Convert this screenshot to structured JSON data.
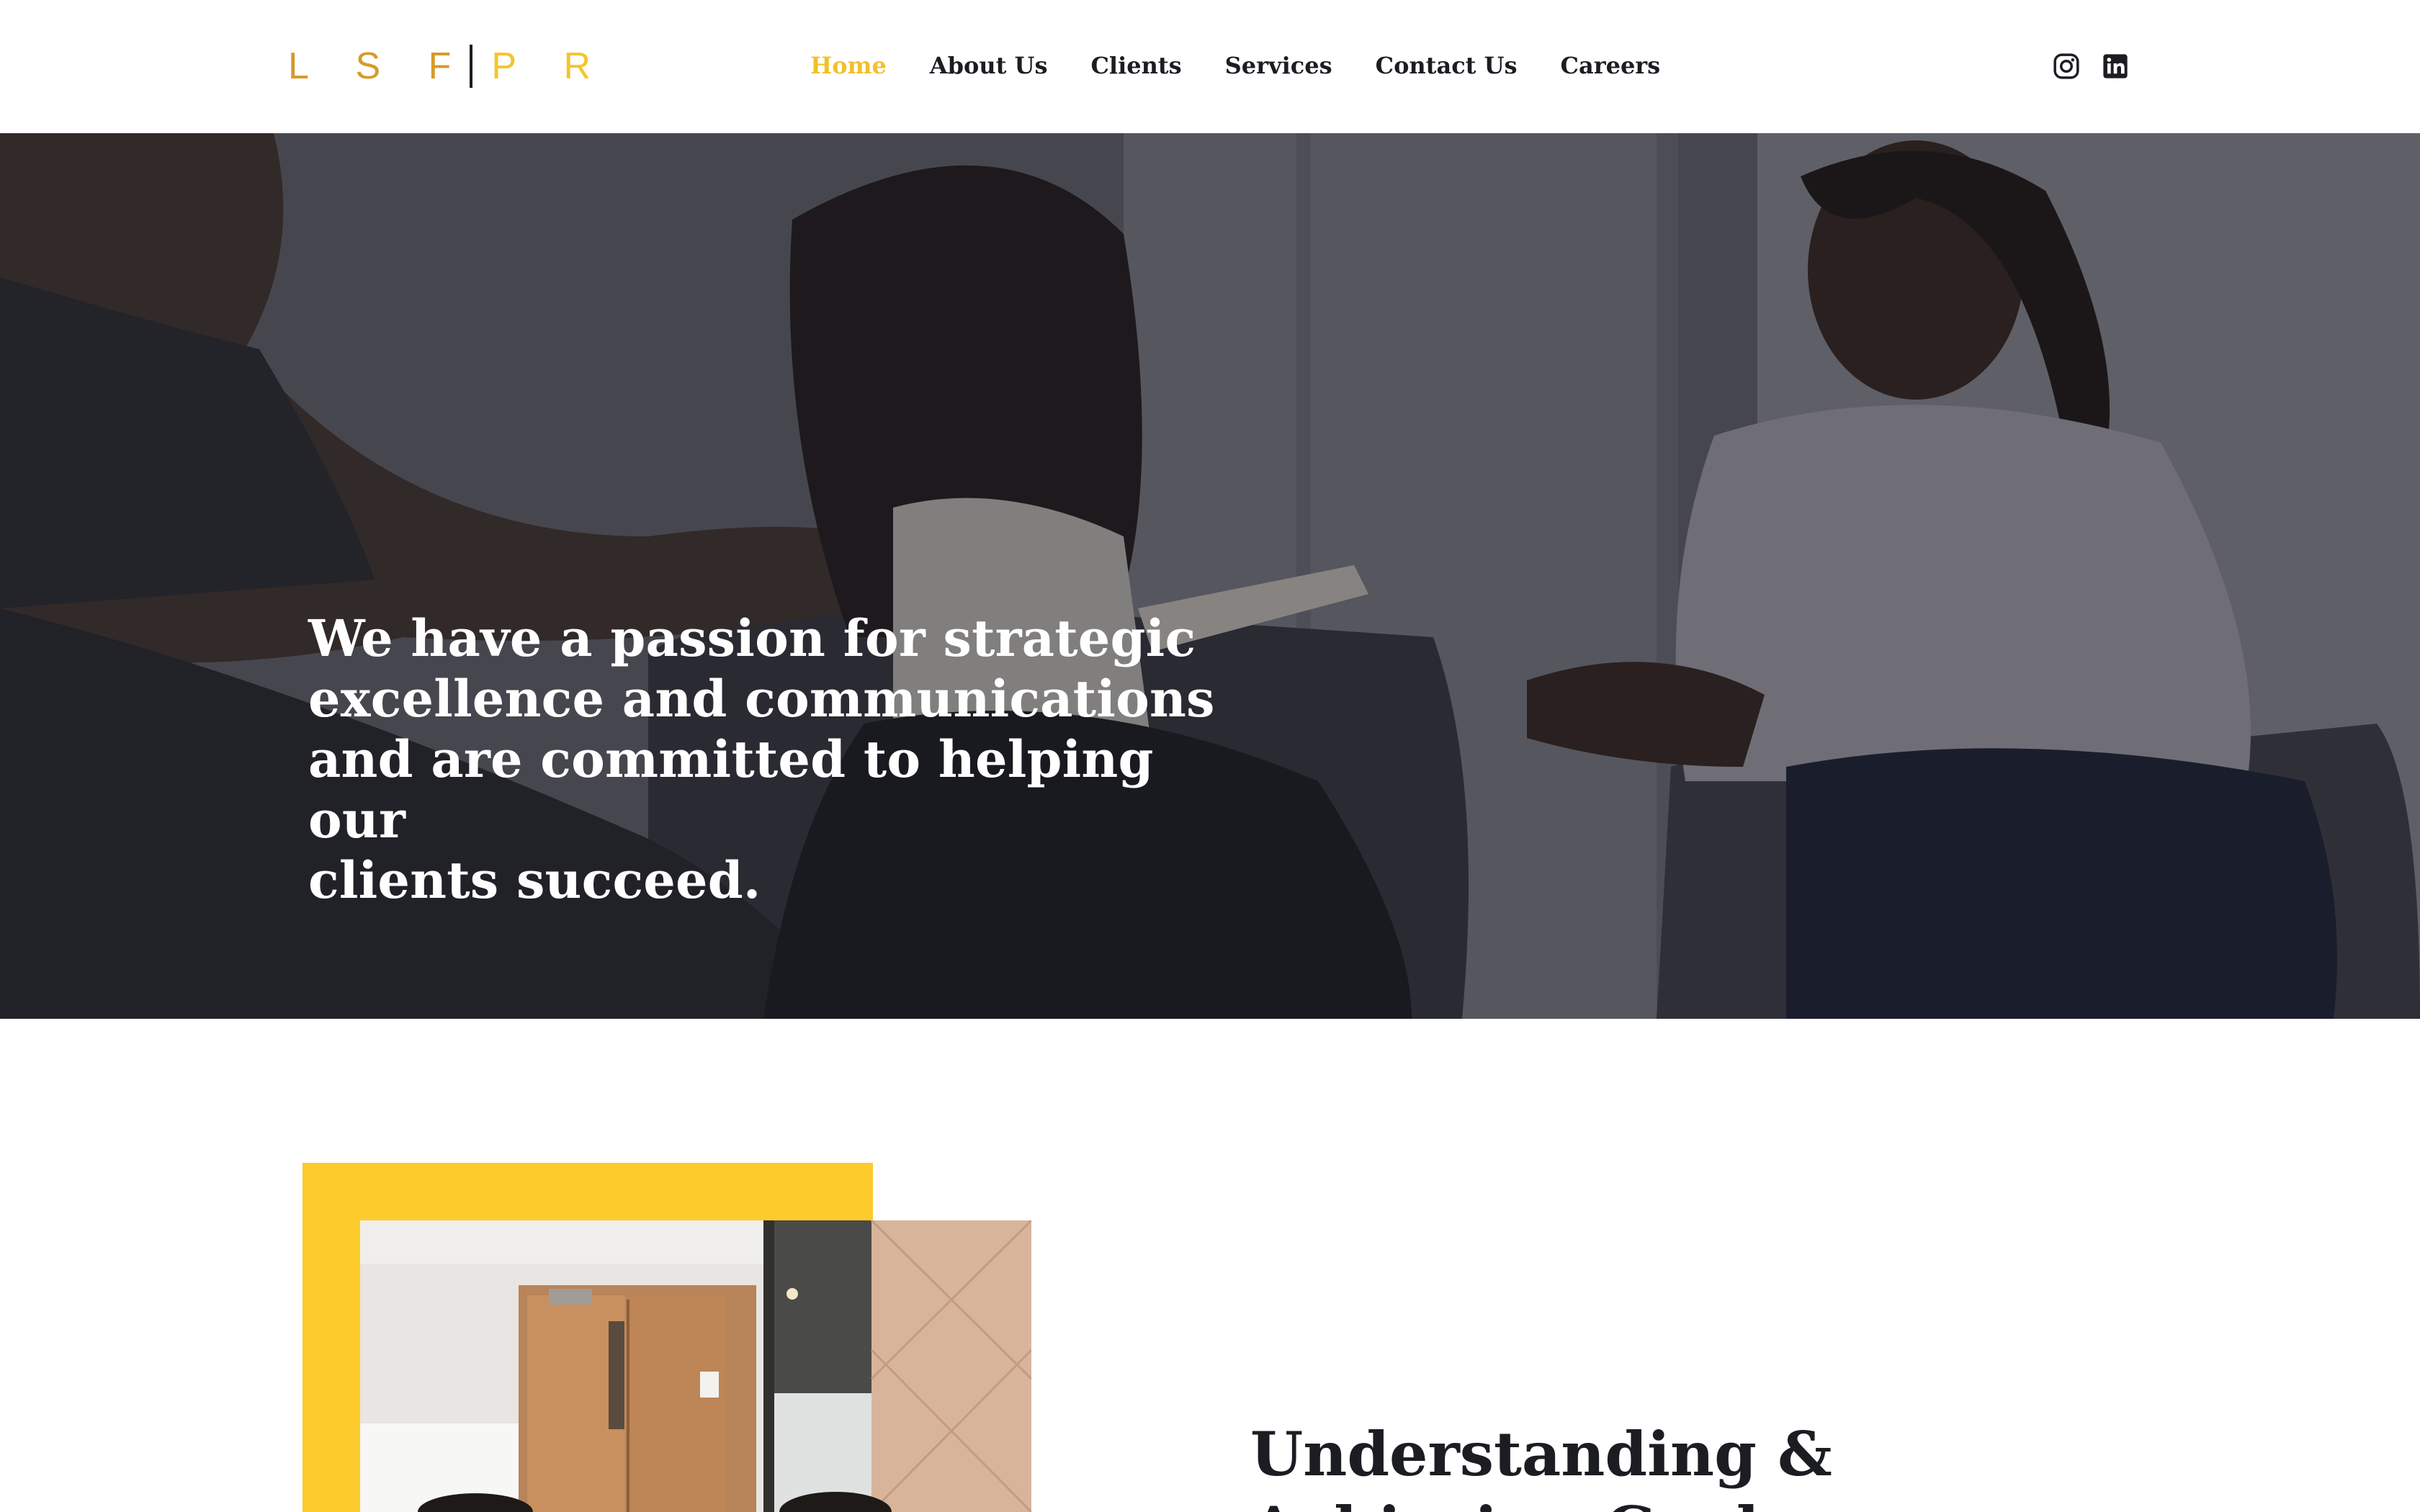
{
  "header": {
    "logo": {
      "left": "L S F",
      "right": "P R"
    },
    "nav": [
      {
        "label": "Home",
        "active": true
      },
      {
        "label": "About Us",
        "active": false
      },
      {
        "label": "Clients",
        "active": false
      },
      {
        "label": "Services",
        "active": false
      },
      {
        "label": "Contact Us",
        "active": false
      },
      {
        "label": "Careers",
        "active": false
      }
    ],
    "social": [
      "instagram-icon",
      "linkedin-icon"
    ]
  },
  "hero": {
    "headline": "We have a passion for strategic\nexcellence and communications\nand are committed to helping our\nclients succeed."
  },
  "about": {
    "heading": "Understanding &\nAchieving Goals"
  },
  "colors": {
    "accent": "#f2c02c",
    "frame": "#fdcb2c",
    "text": "#1c1d22"
  }
}
